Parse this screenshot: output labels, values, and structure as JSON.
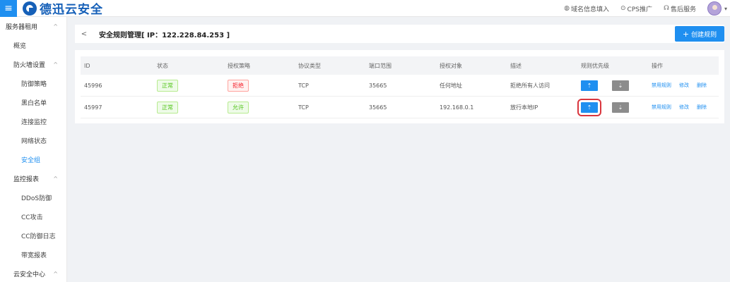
{
  "topbar": {
    "menu_glyph": "≡",
    "brand": "德迅云安全",
    "links": [
      {
        "icon": "◍",
        "label": "域名信息填入"
      },
      {
        "icon": "⊙",
        "label": "CPS推广"
      },
      {
        "icon": "☊",
        "label": "售后服务"
      }
    ],
    "caret": "▾"
  },
  "sidebar": {
    "chev": "^",
    "groups": [
      {
        "label": "服务器租用"
      },
      {
        "label": "防火墙设置"
      },
      {
        "label": "监控报表"
      },
      {
        "label": "云安全中心"
      }
    ],
    "items": {
      "overview": "概览",
      "defense_policy": "防御策略",
      "blackwhite": "黑白名单",
      "conn_monitor": "连接监控",
      "net_status": "网络状态",
      "security_group": "安全组",
      "ddos": "DDoS防御",
      "cc_attack": "CC攻击",
      "cc_log": "CC防御日志",
      "bandwidth": "带宽报表"
    }
  },
  "header": {
    "back_glyph": "<",
    "title": "安全规则管理[ IP：122.228.84.253 ]",
    "create_label": "创建规则",
    "create_glyph": "+"
  },
  "table": {
    "columns": [
      "ID",
      "状态",
      "授权策略",
      "协议类型",
      "端口范围",
      "授权对象",
      "描述",
      "规则优先级",
      "操作"
    ],
    "rows": [
      {
        "id": "45996",
        "status": "正常",
        "policy": "拒绝",
        "protocol": "TCP",
        "port": "35665",
        "target": "任何地址",
        "desc": "拒绝所有人访问"
      },
      {
        "id": "45997",
        "status": "正常",
        "policy": "允许",
        "protocol": "TCP",
        "port": "35665",
        "target": "192.168.0.1",
        "desc": "放行本地IP"
      }
    ],
    "up_glyph": "⇡",
    "down_glyph": "⇣",
    "ops": [
      "禁用规则",
      "修改",
      "删除"
    ]
  },
  "colors": {
    "accent": "#1f8ff0",
    "brand": "#1660b8",
    "success": "#52c41a",
    "danger": "#f5222d",
    "highlight": "#d9363e"
  }
}
